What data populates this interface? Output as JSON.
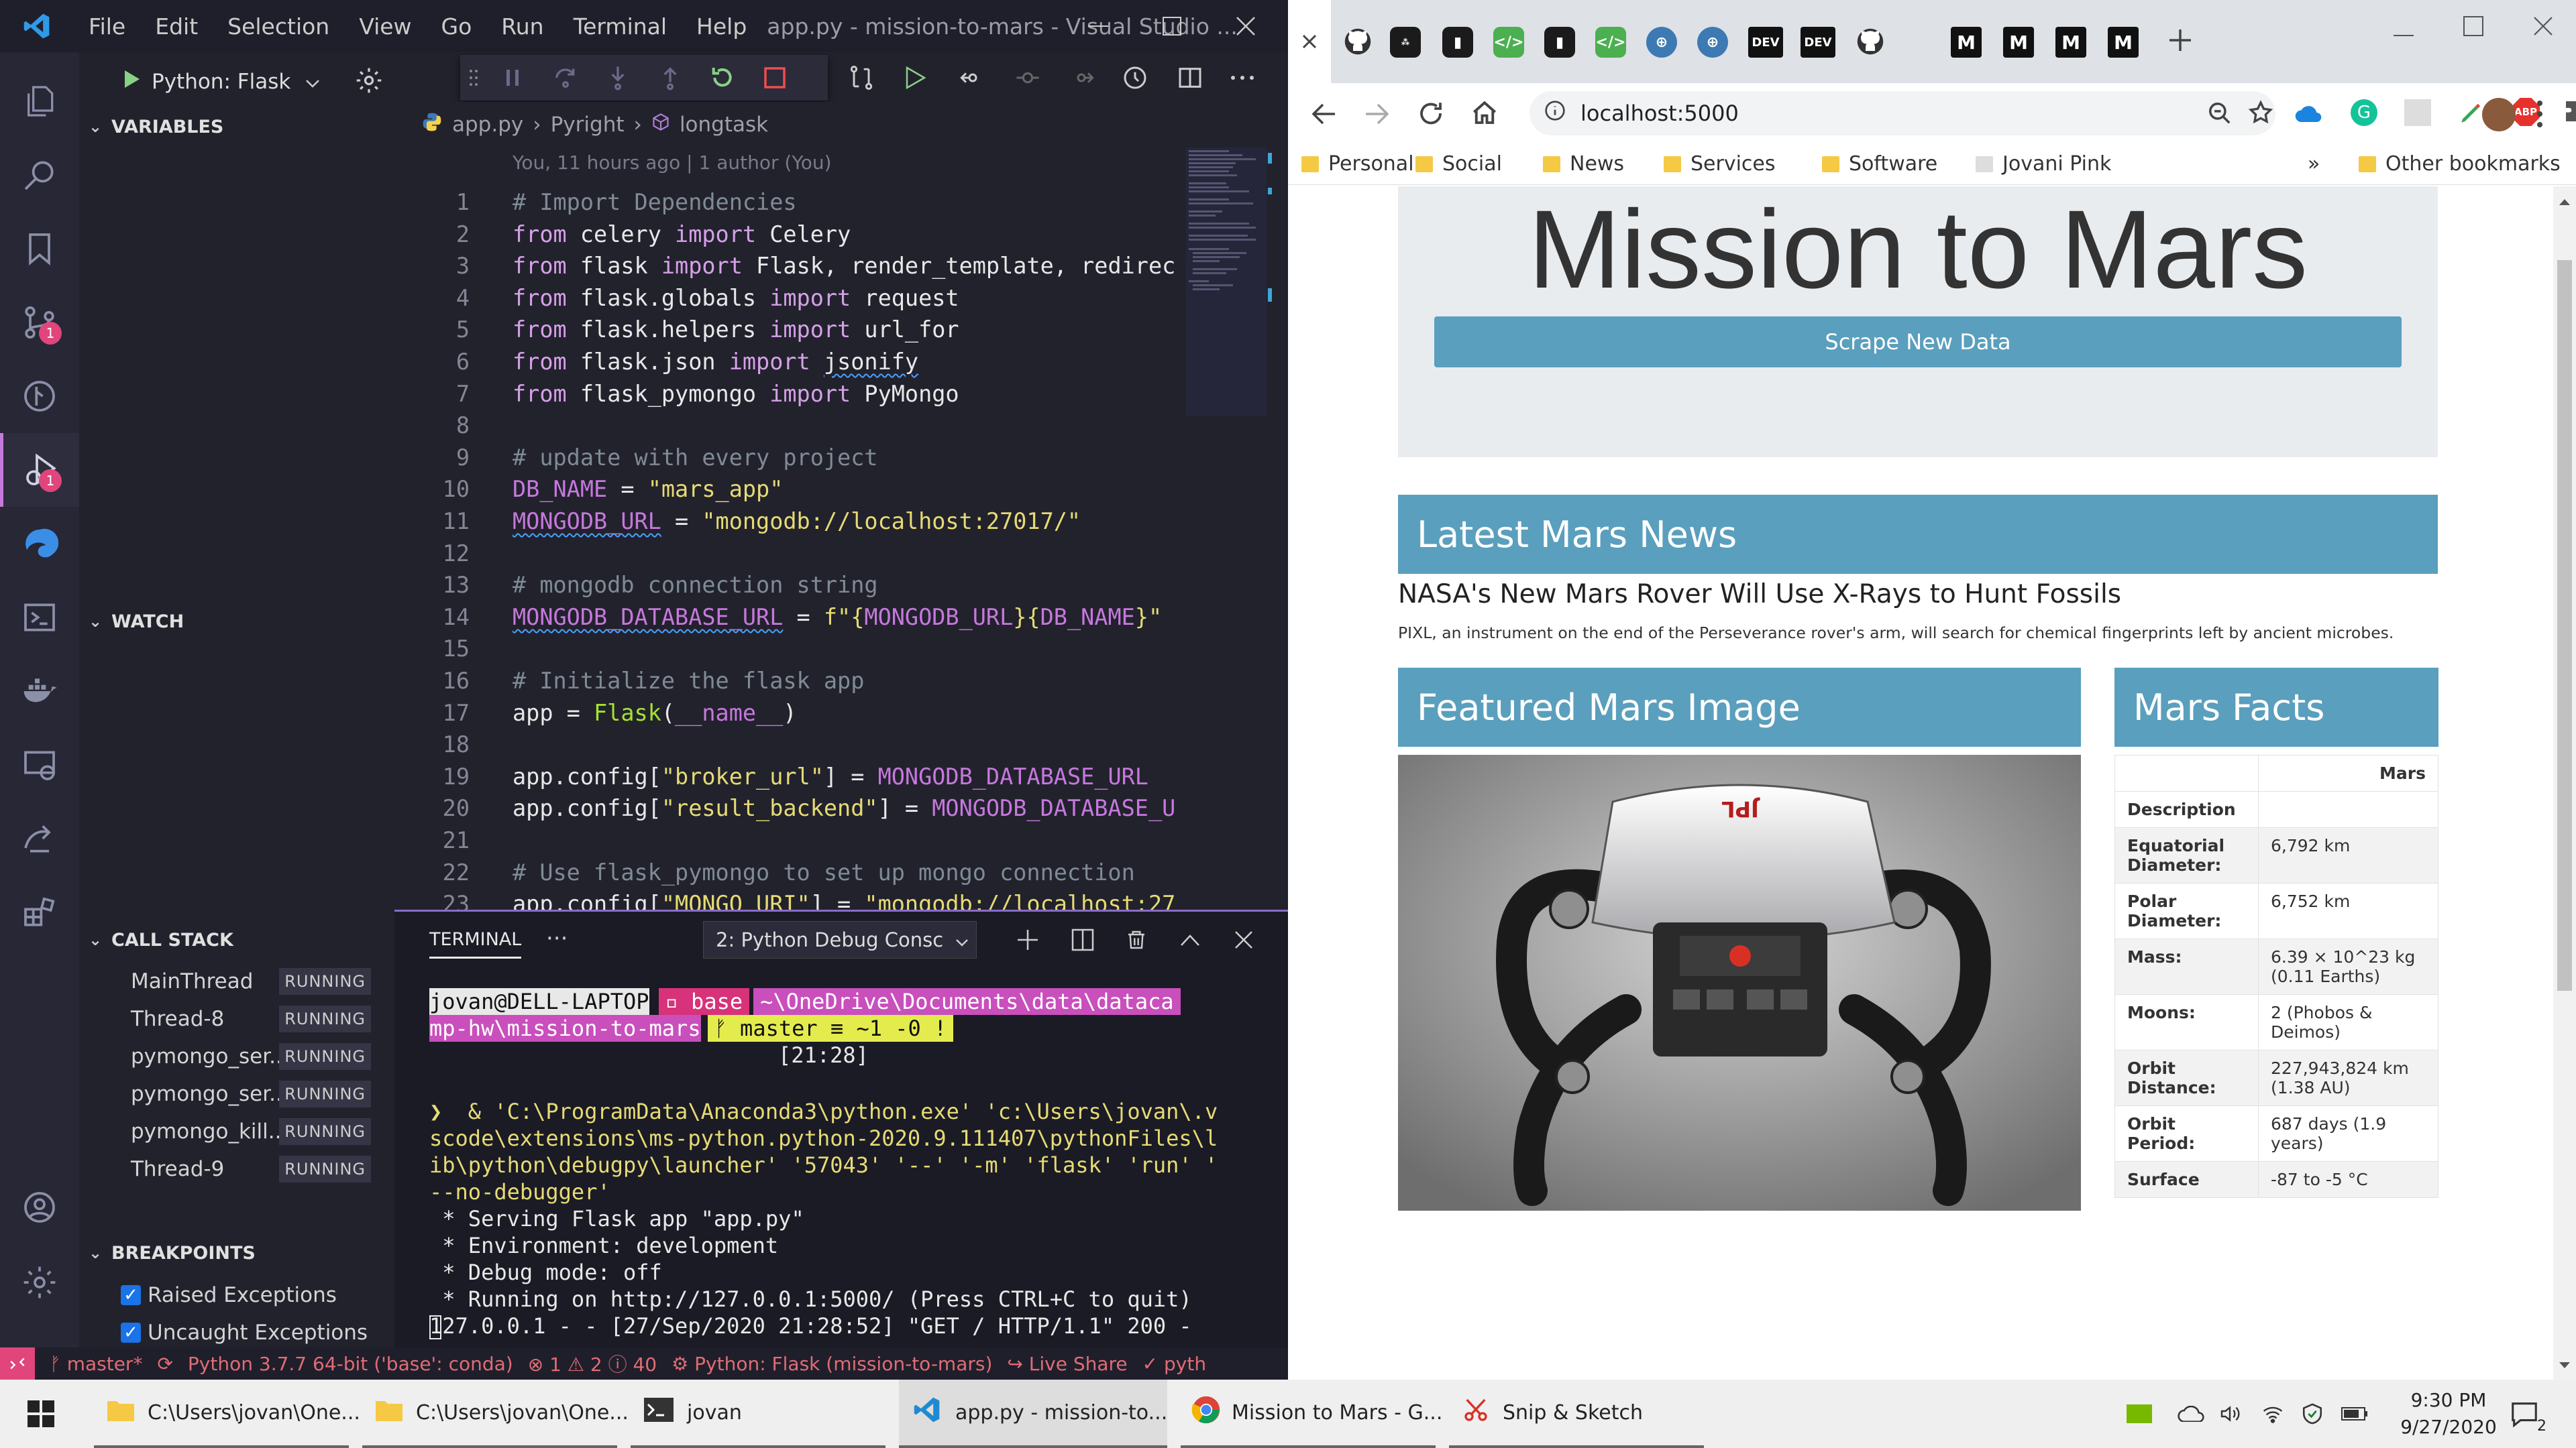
{
  "vscode": {
    "menu": [
      "File",
      "Edit",
      "Selection",
      "View",
      "Go",
      "Run",
      "Terminal",
      "Help"
    ],
    "window_title": "app.py - mission-to-mars - Visual Studio ...",
    "debug_config": "Python: Flask",
    "sections": {
      "variables": "VARIABLES",
      "watch": "WATCH",
      "call_stack": "CALL STACK",
      "breakpoints": "BREAKPOINTS"
    },
    "call_stack": [
      {
        "name": "MainThread",
        "state": "RUNNING"
      },
      {
        "name": "Thread-8",
        "state": "RUNNING"
      },
      {
        "name": "pymongo_ser...",
        "state": "RUNNING"
      },
      {
        "name": "pymongo_ser...",
        "state": "RUNNING"
      },
      {
        "name": "pymongo_kill...",
        "state": "RUNNING"
      },
      {
        "name": "Thread-9",
        "state": "RUNNING"
      }
    ],
    "breakpoints": [
      {
        "label": "Raised Exceptions",
        "checked": true
      },
      {
        "label": "Uncaught Exceptions",
        "checked": true
      }
    ],
    "breadcrumb": {
      "file": "app.py",
      "lang": "Pyright",
      "symbol": "longtask"
    },
    "blame": "You, 11 hours ago | 1 author (You)",
    "activity_badges": {
      "source_control": "1",
      "debug": "1"
    },
    "terminal": {
      "tab": "TERMINAL",
      "more": "···",
      "selector": "2: Python Debug Consc",
      "prompt_user": "jovan@DELL-LAPTOP",
      "prompt_env": "base",
      "prompt_path_1": "~\\OneDrive\\Documents\\data\\dataca",
      "prompt_path_2": "mp-hw\\mission-to-mars",
      "prompt_git": " master ≡ ~1 -0 !",
      "prompt_time": "[21:28]",
      "cmd_lines": [
        "❯  & 'C:\\ProgramData\\Anaconda3\\python.exe' 'c:\\Users\\jovan\\.v",
        "scode\\extensions\\ms-python.python-2020.9.111407\\pythonFiles\\l",
        "ib\\python\\debugpy\\launcher' '57043' '--' '-m' 'flask' 'run' '",
        "--no-debugger'"
      ],
      "out_lines": [
        " * Serving Flask app \"app.py\"",
        " * Environment: development",
        " * Debug mode: off",
        " * Running on http://127.0.0.1:5000/ (Press CTRL+C to quit)",
        "127.0.0.1 - - [27/Sep/2020 21:28:52] \"GET / HTTP/1.1\" 200 -"
      ]
    },
    "status": {
      "branch": "master*",
      "python": "Python 3.7.7 64-bit ('base': conda)",
      "errors": "1",
      "warnings": "2",
      "info": "40",
      "debug": "Python: Flask (mission-to-mars)",
      "liveshare": "Live Share",
      "tail": "pyth"
    }
  },
  "code_lines": [
    [
      [
        "cm",
        "# Import Dependencies"
      ]
    ],
    [
      [
        "kw",
        "from"
      ],
      [
        "pl",
        " celery "
      ],
      [
        "kw",
        "import"
      ],
      [
        "pl",
        " Celery"
      ]
    ],
    [
      [
        "kw",
        "from"
      ],
      [
        "pl",
        " flask "
      ],
      [
        "kw",
        "import"
      ],
      [
        "pl",
        " Flask, render_template, redirec"
      ]
    ],
    [
      [
        "kw",
        "from"
      ],
      [
        "pl",
        " flask.globals "
      ],
      [
        "kw",
        "import"
      ],
      [
        "pl",
        " request"
      ]
    ],
    [
      [
        "kw",
        "from"
      ],
      [
        "pl",
        " flask.helpers "
      ],
      [
        "kw",
        "import"
      ],
      [
        "pl",
        " url_for"
      ]
    ],
    [
      [
        "kw",
        "from"
      ],
      [
        "pl",
        " flask.json "
      ],
      [
        "kw",
        "import"
      ],
      [
        "pl",
        " "
      ],
      [
        "sq",
        "jsonify"
      ]
    ],
    [
      [
        "kw",
        "from"
      ],
      [
        "pl",
        " flask_pymongo "
      ],
      [
        "kw",
        "import"
      ],
      [
        "pl",
        " PyMongo"
      ]
    ],
    [],
    [
      [
        "cm",
        "# update with every project"
      ]
    ],
    [
      [
        "var",
        "DB_NAME"
      ],
      [
        "pl",
        " = "
      ],
      [
        "st2",
        "\"mars_app\""
      ]
    ],
    [
      [
        "vsq",
        "MONGODB_URL"
      ],
      [
        "pl",
        " = "
      ],
      [
        "st2",
        "\"mongodb://localhost:27017/\""
      ]
    ],
    [],
    [
      [
        "cm",
        "# mongodb connection string"
      ]
    ],
    [
      [
        "vsq",
        "MONGODB_DATABASE_URL"
      ],
      [
        "pl",
        " = "
      ],
      [
        "st2",
        "f\"{"
      ],
      [
        "var",
        "MONGODB_URL"
      ],
      [
        "st2",
        "}{"
      ],
      [
        "var",
        "DB_NAME"
      ],
      [
        "st2",
        "}\""
      ]
    ],
    [],
    [
      [
        "cm",
        "# Initialize the flask app"
      ]
    ],
    [
      [
        "pl",
        "app = "
      ],
      [
        "fn",
        "Flask"
      ],
      [
        "pl",
        "("
      ],
      [
        "var",
        "__name__"
      ],
      [
        "pl",
        ")"
      ]
    ],
    [],
    [
      [
        "pl",
        "app.config["
      ],
      [
        "st2",
        "\"broker_url\""
      ],
      [
        "pl",
        "] = "
      ],
      [
        "var",
        "MONGODB_DATABASE_URL"
      ]
    ],
    [
      [
        "pl",
        "app.config["
      ],
      [
        "st2",
        "\"result_backend\""
      ],
      [
        "pl",
        "] = "
      ],
      [
        "var",
        "MONGODB_DATABASE_U"
      ]
    ],
    [],
    [
      [
        "cm",
        "# Use flask_pymongo to set up mongo connection"
      ]
    ],
    [
      [
        "pl",
        "app.config["
      ],
      [
        "st2",
        "\"MONGO_URI\""
      ],
      [
        "pl",
        "] = "
      ],
      [
        "st2",
        "\"mongodb://localhost:27"
      ]
    ]
  ],
  "chrome": {
    "url": "localhost:5000",
    "tab_labels": [
      "DEV",
      "DEV",
      "M",
      "M",
      "M",
      "M"
    ],
    "bookmarks": [
      "Personal",
      "Social",
      "News",
      "Services",
      "Software",
      "Jovani Pink"
    ],
    "other_bookmarks": "Other bookmarks",
    "ext_abp": "ABP"
  },
  "site": {
    "title": "Mission to Mars",
    "scrape_button": "Scrape New Data",
    "news_header": "Latest Mars News",
    "news_title": "NASA's New Mars Rover Will Use X-Rays to Hunt Fossils",
    "news_paragraph": "PIXL, an instrument on the end of the Perseverance rover's arm, will search for chemical fingerprints left by ancient microbes.",
    "image_header": "Featured Mars Image",
    "facts_header": "Mars Facts",
    "facts_column": "Mars",
    "facts": [
      {
        "label": "Description",
        "value": ""
      },
      {
        "label": "Equatorial Diameter:",
        "value": "6,792 km"
      },
      {
        "label": "Polar Diameter:",
        "value": "6,752 km"
      },
      {
        "label": "Mass:",
        "value": "6.39 × 10^23 kg (0.11 Earths)"
      },
      {
        "label": "Moons:",
        "value": "2 (Phobos & Deimos)"
      },
      {
        "label": "Orbit Distance:",
        "value": "227,943,824 km (1.38 AU)"
      },
      {
        "label": "Orbit Period:",
        "value": "687 days (1.9 years)"
      },
      {
        "label": "Surface",
        "value": "-87 to -5 °C"
      }
    ],
    "robot_logo": "JPL"
  },
  "taskbar": {
    "items": [
      "C:\\Users\\jovan\\One...",
      "C:\\Users\\jovan\\One...",
      "jovan",
      "app.py - mission-to...",
      "Mission to Mars - G...",
      "Snip & Sketch"
    ],
    "time": "9:30 PM",
    "date": "9/27/2020",
    "notifications": "2"
  }
}
